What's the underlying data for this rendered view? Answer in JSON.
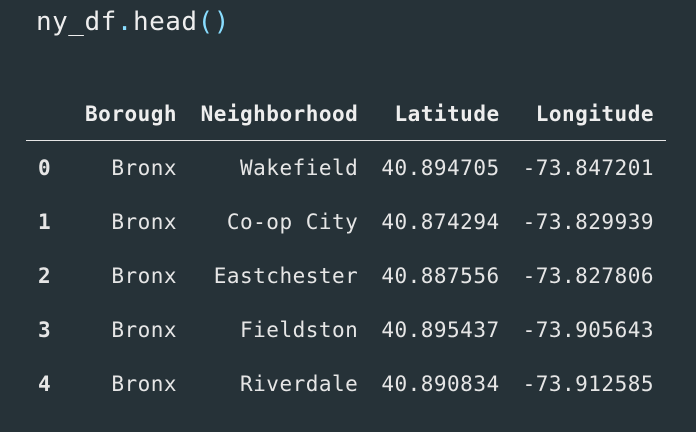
{
  "code": {
    "variable": "ny_df",
    "dot": ".",
    "method": "head",
    "parens": "()"
  },
  "table": {
    "columns": [
      "",
      "Borough",
      "Neighborhood",
      "Latitude",
      "Longitude"
    ],
    "rows": [
      {
        "index": "0",
        "borough": "Bronx",
        "neighborhood": "Wakefield",
        "latitude": "40.894705",
        "longitude": "-73.847201"
      },
      {
        "index": "1",
        "borough": "Bronx",
        "neighborhood": "Co-op City",
        "latitude": "40.874294",
        "longitude": "-73.829939"
      },
      {
        "index": "2",
        "borough": "Bronx",
        "neighborhood": "Eastchester",
        "latitude": "40.887556",
        "longitude": "-73.827806"
      },
      {
        "index": "3",
        "borough": "Bronx",
        "neighborhood": "Fieldston",
        "latitude": "40.895437",
        "longitude": "-73.905643"
      },
      {
        "index": "4",
        "borough": "Bronx",
        "neighborhood": "Riverdale",
        "latitude": "40.890834",
        "longitude": "-73.912585"
      }
    ]
  }
}
